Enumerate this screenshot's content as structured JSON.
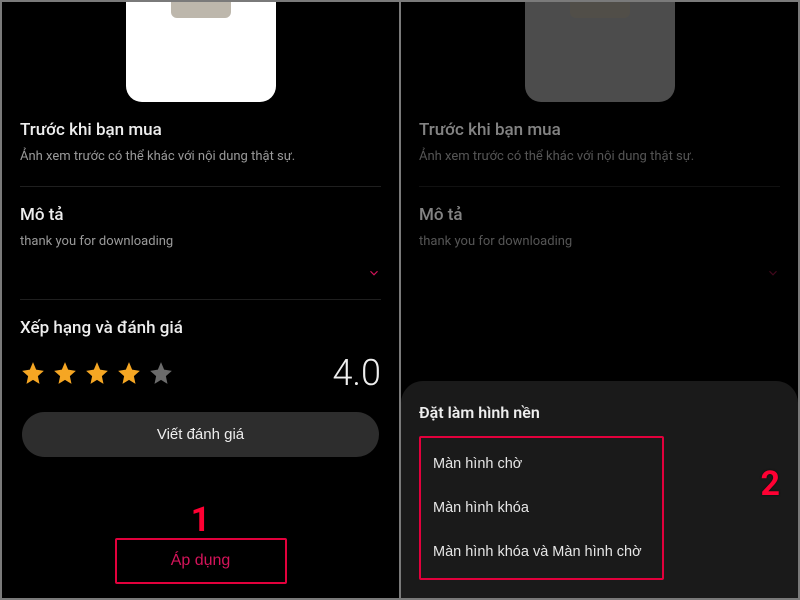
{
  "left": {
    "before_buy": {
      "title": "Trước khi bạn mua",
      "note": "Ảnh xem trước có thể khác với nội dung thật sự."
    },
    "description": {
      "title": "Mô tả",
      "body": "thank you for downloading"
    },
    "ratings": {
      "title": "Xếp hạng và đánh giá",
      "stars_full": 4,
      "stars_total": 5,
      "score": "4.0"
    },
    "write_review": "Viết đánh giá",
    "apply": "Áp dụng",
    "step_badge": "1"
  },
  "right": {
    "before_buy": {
      "title": "Trước khi bạn mua",
      "note": "Ảnh xem trước có thể khác với nội dung thật sự."
    },
    "description": {
      "title": "Mô tả",
      "body": "thank you for downloading"
    },
    "sheet": {
      "title": "Đặt làm hình nền",
      "options": [
        "Màn hình chờ",
        "Màn hình khóa",
        "Màn hình khóa và Màn hình chờ"
      ]
    },
    "step_badge": "2"
  },
  "colors": {
    "accent": "#e2003c",
    "star": "#f5a623"
  }
}
